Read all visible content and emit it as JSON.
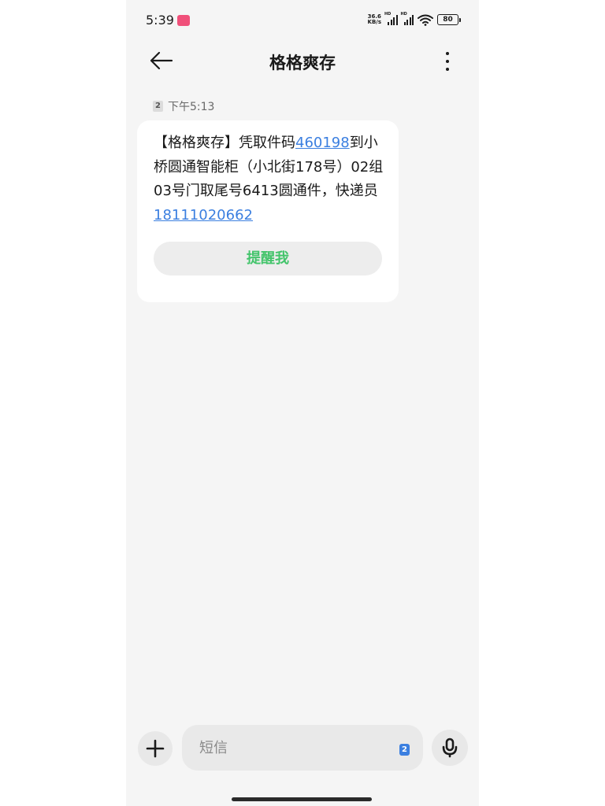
{
  "status_bar": {
    "time": "5:39",
    "net_speed_value": "36.6",
    "net_speed_unit": "KB/s",
    "signal_label": "HD",
    "battery": "80"
  },
  "header": {
    "title": "格格爽存"
  },
  "message": {
    "sim": "2",
    "time": "下午5:13",
    "text_before_code": "【格格爽存】凭取件码",
    "pickup_code": "460198",
    "text_after_code": "到小桥圆通智能柜（小北街178号）02组03号门取尾号6413圆通件，快递员",
    "courier_phone": "18111020662",
    "remind_label": "提醒我"
  },
  "composer": {
    "placeholder": "短信",
    "sim": "2"
  },
  "colors": {
    "link": "#3b7fe0",
    "remind": "#43c46b",
    "background": "#f5f5f5"
  }
}
